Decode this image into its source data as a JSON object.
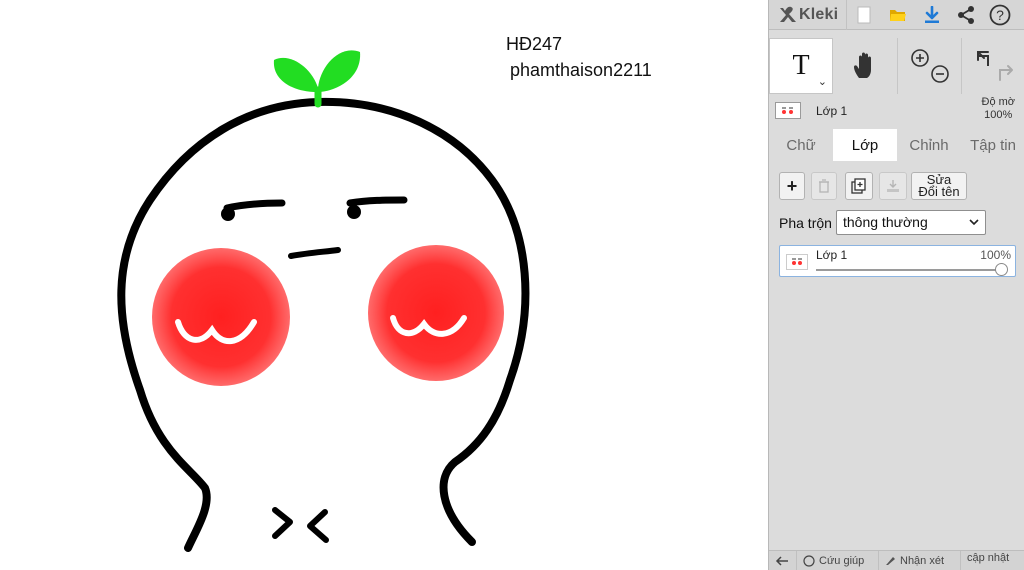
{
  "canvas": {
    "text_line1": "HĐ247",
    "text_line2": "phamthaison2211"
  },
  "app": {
    "logo_text": "Kleki"
  },
  "topbar": {
    "icons": [
      "new-file-icon",
      "open-folder-icon",
      "download-icon",
      "share-icon",
      "help-icon"
    ]
  },
  "tools": {
    "text_tool_glyph": "T"
  },
  "layer_header": {
    "layer_name": "Lớp 1",
    "opacity_label": "Độ mờ",
    "opacity_value": "100%"
  },
  "tabs": [
    {
      "label": "Chữ"
    },
    {
      "label": "Lớp"
    },
    {
      "label": "Chỉnh"
    },
    {
      "label": "Tập tin"
    }
  ],
  "layers_panel": {
    "add_label": "+",
    "rename_line1": "Sửa",
    "rename_line2": "Đổi tên",
    "blend_label": "Pha trộn",
    "blend_value": "thông thường",
    "layers": [
      {
        "name": "Lớp 1",
        "opacity": "100%",
        "opacity_fraction": 1.0
      }
    ]
  },
  "bottombar": {
    "help_label": "Cứu giúp",
    "feedback_label": "Nhận xét",
    "update_label": "cập nhật"
  },
  "colors": {
    "panel_bg": "#dcdcdc",
    "accent_blue": "#1f7ad6",
    "sprout_green": "#22dd22",
    "blush_red": "#ff2a2a",
    "folder_yellow": "#f2c100"
  }
}
